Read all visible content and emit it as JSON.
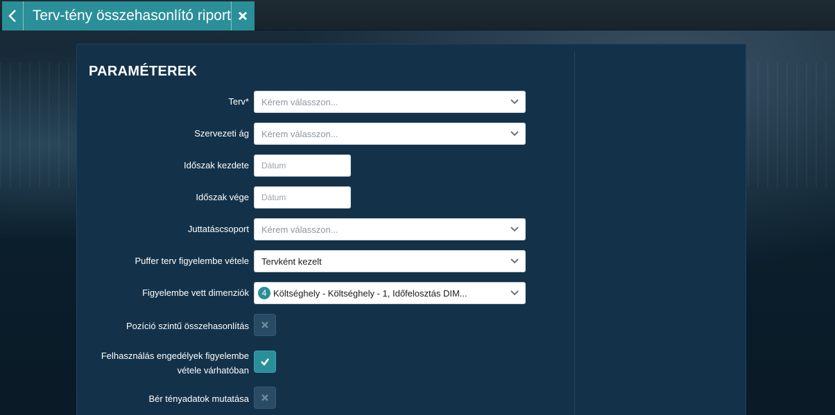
{
  "header": {
    "title": "Terv-tény összehasonlító riport"
  },
  "icons": {
    "back": "chevron-left-icon",
    "close": "close-icon",
    "dropdown": "chevron-down-icon",
    "check": "check-icon",
    "cross": "x-icon"
  },
  "colors": {
    "accent": "#2a8f98",
    "panel": "#13324a",
    "toggle_off": "#2a4b64"
  },
  "panel": {
    "title": "PARAMÉTEREK"
  },
  "fields": {
    "terv": {
      "label": "Terv*",
      "placeholder": "Kérem válasszon..."
    },
    "szervezeti_ag": {
      "label": "Szervezeti ág",
      "placeholder": "Kérem válasszon..."
    },
    "idoszak_kezdete": {
      "label": "Időszak kezdete",
      "placeholder": "Dátum"
    },
    "idoszak_vege": {
      "label": "Időszak vége",
      "placeholder": "Dátum"
    },
    "juttatascsoport": {
      "label": "Juttatáscsoport",
      "placeholder": "Kérem válasszon..."
    },
    "puffer": {
      "label": "Puffer terv figyelembe vétele",
      "value": "Tervként kezelt"
    },
    "dimenziok": {
      "label": "Figyelembe vett dimenziók",
      "count": "4",
      "value": "Költséghely - Költséghely - 1, Időfelosztás DIM..."
    },
    "pozicio": {
      "label": "Pozíció szintű összehasonlítás",
      "checked": false
    },
    "felhasznalas": {
      "label_line1": "Felhasználás engedélyek figyelembe",
      "label_line2": "vétele várhatóban",
      "checked": true
    },
    "ber": {
      "label": "Bér tényadatok mutatása",
      "checked": false
    }
  }
}
